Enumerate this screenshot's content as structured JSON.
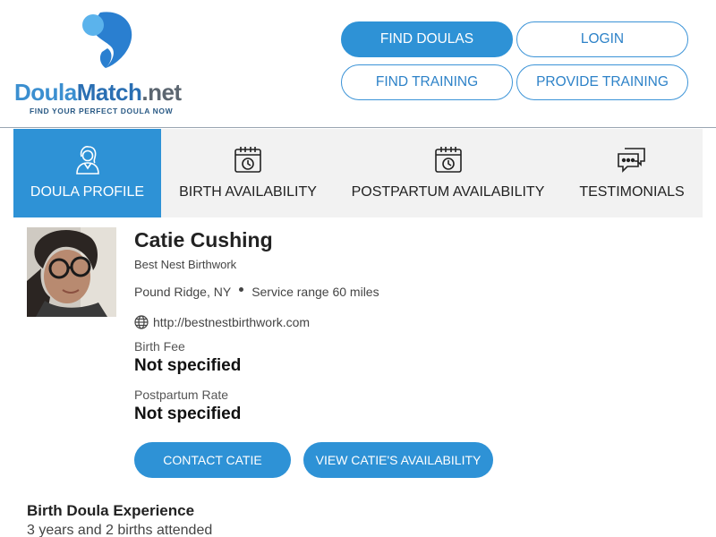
{
  "logo": {
    "text_part1": "Doula",
    "text_part2": "Match",
    "text_part3": ".net",
    "tagline": "FIND YOUR PERFECT DOULA NOW",
    "colors": {
      "light_blue": "#5bb3ec",
      "dark_blue": "#2a7fd0",
      "grey": "#5c6670"
    }
  },
  "nav": {
    "find_doulas": "FIND DOULAS",
    "login": "LOGIN",
    "find_training": "FIND TRAINING",
    "provide_training": "PROVIDE TRAINING"
  },
  "tabs": [
    {
      "label": "DOULA PROFILE",
      "icon": "doula-avatar-icon",
      "active": true
    },
    {
      "label": "BIRTH AVAILABILITY",
      "icon": "calendar-clock-icon",
      "active": false
    },
    {
      "label": "POSTPARTUM AVAILABILITY",
      "icon": "calendar-clock-icon",
      "active": false
    },
    {
      "label": "TESTIMONIALS",
      "icon": "chat-bubbles-icon",
      "active": false
    }
  ],
  "profile": {
    "name": "Catie Cushing",
    "business": "Best Nest Birthwork",
    "location": "Pound Ridge, NY",
    "service_range": "Service range 60 miles",
    "website": "http://bestnestbirthwork.com",
    "birth_fee_label": "Birth Fee",
    "birth_fee_value": "Not specified",
    "postpartum_label": "Postpartum Rate",
    "postpartum_value": "Not specified",
    "contact_button": "CONTACT CATIE",
    "availability_button": "VIEW CATIE'S AVAILABILITY"
  },
  "experience": {
    "title": "Birth Doula Experience",
    "text": "3 years and 2 births attended"
  },
  "colors": {
    "accent": "#2e92d6",
    "tab_bg": "#f2f2f2"
  }
}
